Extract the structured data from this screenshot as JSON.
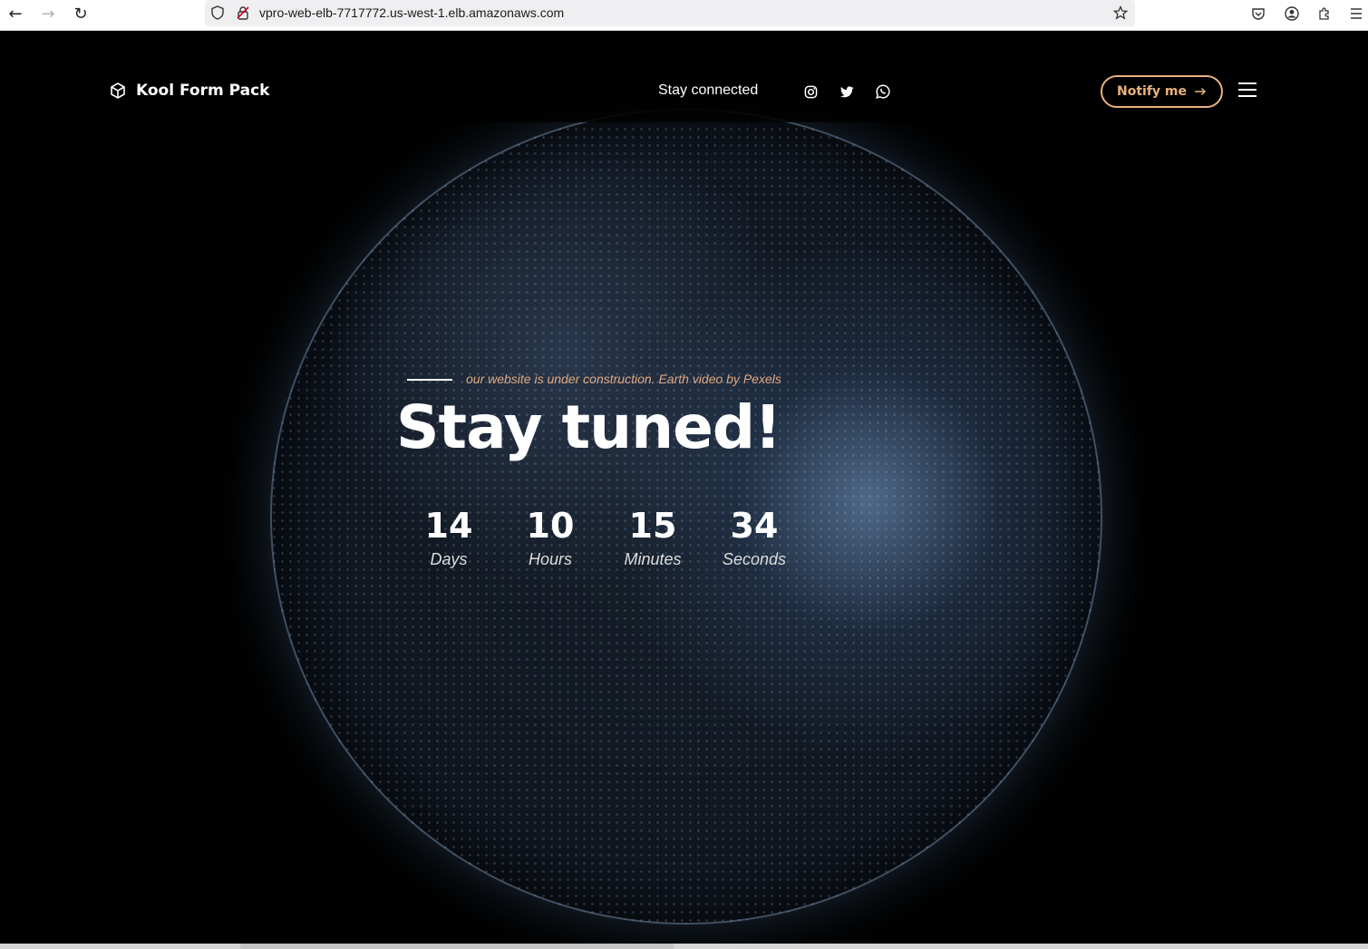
{
  "browser": {
    "url": "vpro-web-elb-7717772.us-west-1.elb.amazonaws.com",
    "back_icon": "back-arrow-icon",
    "forward_icon": "forward-arrow-icon",
    "reload_icon": "reload-icon"
  },
  "header": {
    "brand_name": "Kool Form Pack",
    "stay_connected": "Stay connected",
    "social": [
      "instagram-icon",
      "twitter-icon",
      "whatsapp-icon"
    ],
    "notify_label": "Notify me",
    "notify_color": "#e9b27e"
  },
  "hero": {
    "tagline": "our website is under construction. Earth video by Pexels",
    "headline": "Stay tuned!"
  },
  "countdown": [
    {
      "value": "14",
      "label": "Days"
    },
    {
      "value": "10",
      "label": "Hours"
    },
    {
      "value": "15",
      "label": "Minutes"
    },
    {
      "value": "34",
      "label": "Seconds"
    }
  ]
}
